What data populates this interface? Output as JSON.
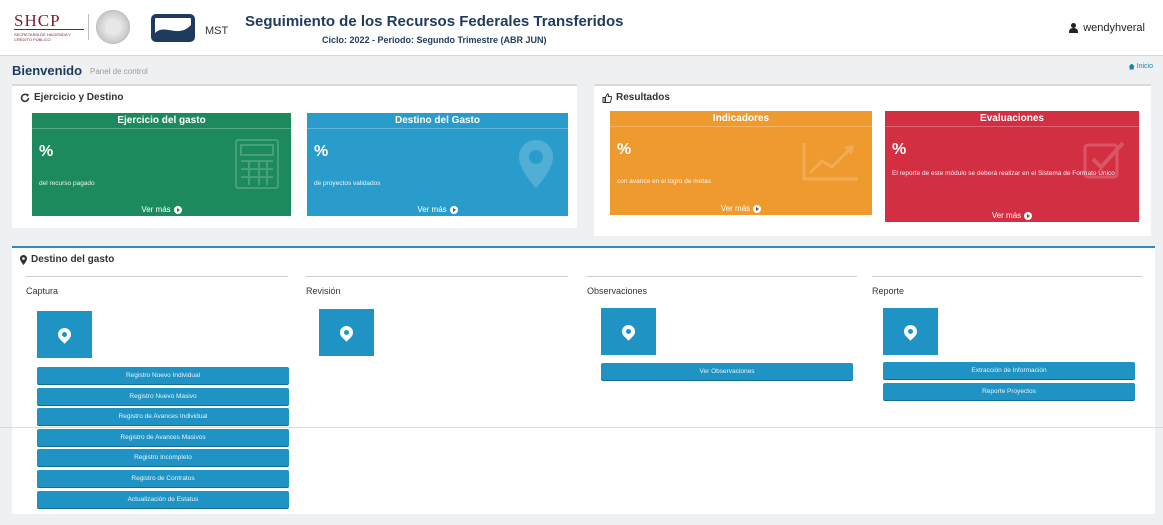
{
  "header": {
    "brand_shcp": "SHCP",
    "brand_shcp_sub": "SECRETARÍA DE HACIENDA Y CRÉDITO PÚBLICO",
    "brand_mst": "MST",
    "title": "Seguimiento de los Recursos Federales Transferidos",
    "subtitle": "Ciclo: 2022 - Periodo: Segundo Trimestre (ABR JUN)",
    "user_name": "wendyhveral"
  },
  "page": {
    "title": "Bienvenido",
    "subtitle": "Panel de control",
    "home_link": "Inicio"
  },
  "ejercicio_panel": {
    "heading": "Ejercicio y Destino",
    "cards": [
      {
        "title": "Ejercicio del gasto",
        "value": "%",
        "desc": "del recurso pagado",
        "more": "Ver más",
        "color": "#1d8a5e",
        "icon": "calculator-icon"
      },
      {
        "title": "Destino del Gasto",
        "value": "%",
        "desc": "de proyectos validados",
        "more": "Ver más",
        "color": "#2a9ccc",
        "icon": "map-marker-icon"
      }
    ]
  },
  "resultados_panel": {
    "heading": "Resultados",
    "cards": [
      {
        "title": "Indicadores",
        "value": "%",
        "desc": "con avance en el logro de metas",
        "more": "Ver más",
        "color": "#ef9a2e",
        "icon": "line-chart-icon"
      },
      {
        "title": "Evaluaciones",
        "value": "%",
        "desc": "El reporte de este módulo se deberá realizar en el Sistema de Formato Único",
        "more": "Ver más",
        "color": "#d32f43",
        "icon": "check-square-icon"
      }
    ]
  },
  "destino_panel": {
    "heading": "Destino del gasto",
    "columns": [
      {
        "title": "Captura",
        "buttons": [
          "Registro Nuevo Individual",
          "Registro Nuevo Masivo",
          "Registro de Avances Individual",
          "Registro de Avances Masivos",
          "Registro Incompleto",
          "Registro de Contratos",
          "Actualización de Estatus"
        ]
      },
      {
        "title": "Revisión",
        "buttons": []
      },
      {
        "title": "Observaciones",
        "buttons": [
          "Ver Observaciones"
        ]
      },
      {
        "title": "Reporte",
        "buttons": [
          "Extracción de Información",
          "Reporte Proyectos"
        ]
      }
    ]
  }
}
